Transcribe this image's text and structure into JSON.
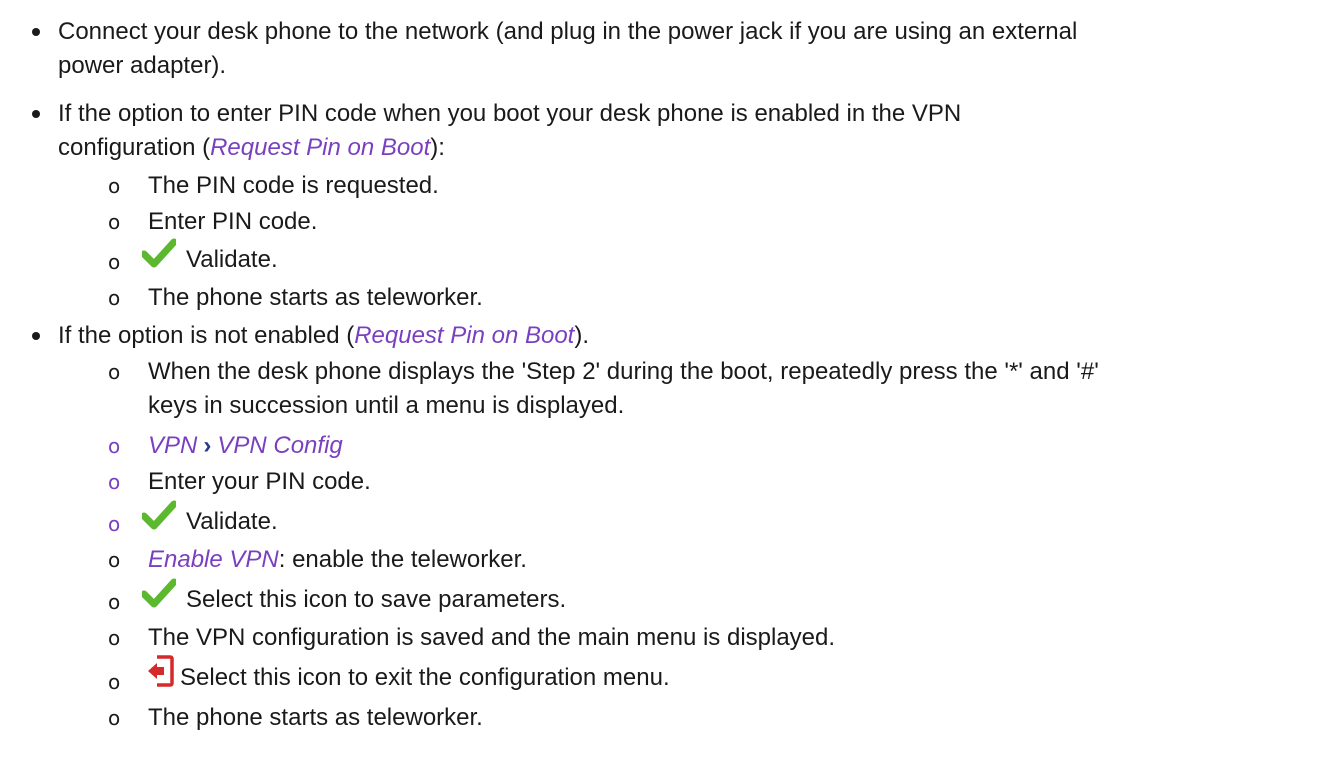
{
  "items": [
    {
      "line1": "Connect your desk phone to the network (and plug in the power jack if you are using an external",
      "line2": "power adapter)."
    },
    {
      "line1": "If the option to enter PIN code when you boot your desk phone is enabled in the VPN",
      "line2_pre": "configuration (",
      "line2_ref": "Request Pin on Boot",
      "line2_post": "):",
      "sub": {
        "s1": "The PIN code is requested.",
        "s2": "Enter PIN code.",
        "s3": "Validate.",
        "s4": "The phone starts as teleworker."
      }
    },
    {
      "pre": "If the option is not enabled (",
      "ref": "Request Pin on Boot",
      "post": ").",
      "sub": {
        "s1_line1": "When the desk phone displays the 'Step 2' during the boot, repeatedly press the '*' and '#'",
        "s1_line2": "keys in succession until a menu is displayed.",
        "s2_part1": "VPN",
        "s2_sep": "›",
        "s2_part2": "VPN Config",
        "s3": "Enter your PIN code.",
        "s4": "Validate.",
        "s5_ref": "Enable VPN",
        "s5_rest": ": enable the teleworker.",
        "s6": "Select this icon to save parameters.",
        "s7": "The VPN configuration is saved and the main menu is displayed.",
        "s8": "Select this icon to exit the configuration menu.",
        "s9": "The phone starts as teleworker."
      }
    }
  ],
  "colors": {
    "reference_text": "#7a3fbf",
    "checkmark": "#5cb82e",
    "exit_icon": "#d42a2a"
  },
  "icons": {
    "validate": "checkmark-icon",
    "exit": "exit-icon"
  }
}
